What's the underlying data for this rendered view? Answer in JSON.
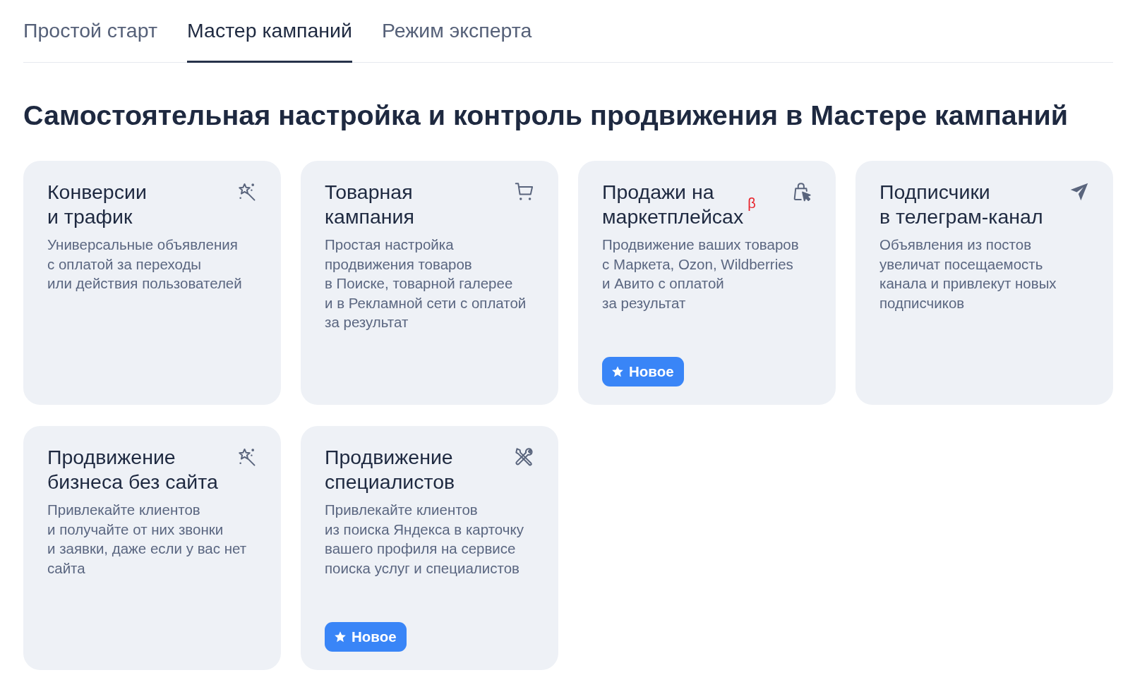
{
  "tabs": [
    {
      "label": "Простой старт",
      "selected": false
    },
    {
      "label": "Мастер кампаний",
      "selected": true
    },
    {
      "label": "Режим эксперта",
      "selected": false
    }
  ],
  "heading": "Самостоятельная настройка и контроль продвижения в Мастере кампаний",
  "cards": [
    {
      "title": "Конверсии\nи трафик",
      "description": "Универсальные объявления\nс оплатой за переходы\nили действия пользователей"
    },
    {
      "title": "Товарная\nкампания",
      "description": "Простая настройка\nпродвижения товаров\nв Поиске, товарной галерее\nи в Рекламной сети с оплатой\nза результат"
    },
    {
      "title": "Продажи на\nмаркетплейсах",
      "superscript": "β",
      "description": "Продвижение ваших товаров\nс Маркета, Ozon, Wildberries\nи Авито с оплатой\nза результат",
      "badge": "Новое"
    },
    {
      "title": "Подписчики\nв телеграм-канал",
      "description": "Объявления из постов\nувеличат посещаемость\nканала и привлекут новых\nподписчиков"
    },
    {
      "title": "Продвижение\nбизнеса без сайта",
      "description": "Привлекайте клиентов\nи получайте от них звонки\nи заявки, даже если у вас нет\nсайта"
    },
    {
      "title": "Продвижение\nспециалистов",
      "description": "Привлекайте клиентов\nиз поиска Яндекса в карточку\nвашего профиля на сервисе\nпоиска услуг и специалистов",
      "badge": "Новое"
    }
  ]
}
